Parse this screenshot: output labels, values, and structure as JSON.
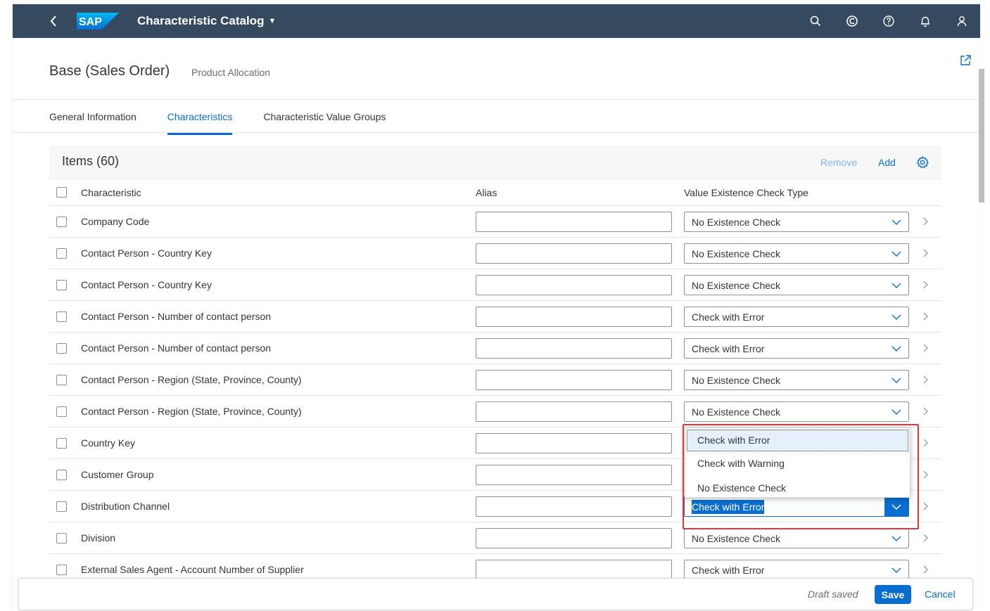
{
  "shell": {
    "logo_text": "SAP",
    "app_title": "Characteristic Catalog",
    "icons": [
      "search-icon",
      "copilot-icon",
      "help-icon",
      "notifications-icon",
      "user-icon"
    ]
  },
  "header": {
    "title": "Base (Sales Order)",
    "subtitle": "Product Allocation"
  },
  "tabs": [
    {
      "label": "General Information",
      "active": false
    },
    {
      "label": "Characteristics",
      "active": true
    },
    {
      "label": "Characteristic Value Groups",
      "active": false
    }
  ],
  "table": {
    "title": "Items (60)",
    "remove_label": "Remove",
    "add_label": "Add",
    "columns": {
      "characteristic": "Characteristic",
      "alias": "Alias",
      "check_type": "Value Existence Check Type"
    },
    "rows": [
      {
        "characteristic": "Company Code",
        "check_type": "No Existence Check"
      },
      {
        "characteristic": "Contact Person - Country Key",
        "check_type": "No Existence Check"
      },
      {
        "characteristic": "Contact Person - Country Key",
        "check_type": "No Existence Check"
      },
      {
        "characteristic": "Contact Person - Number of contact person",
        "check_type": "Check with Error"
      },
      {
        "characteristic": "Contact Person - Number of contact person",
        "check_type": "Check with Error"
      },
      {
        "characteristic": "Contact Person - Region (State, Province, County)",
        "check_type": "No Existence Check"
      },
      {
        "characteristic": "Contact Person - Region (State, Province, County)",
        "check_type": "No Existence Check"
      },
      {
        "characteristic": "Country Key",
        "check_type": ""
      },
      {
        "characteristic": "Customer Group",
        "check_type": ""
      },
      {
        "characteristic": "Distribution Channel",
        "check_type": "Check with Error"
      },
      {
        "characteristic": "Division",
        "check_type": "No Existence Check"
      },
      {
        "characteristic": "External Sales Agent - Account Number of Supplier",
        "check_type": "Check with Error"
      }
    ]
  },
  "dropdown": {
    "options": [
      "Check with Error",
      "Check with Warning",
      "No Existence Check"
    ],
    "selected": "Check with Error"
  },
  "footer": {
    "status": "Draft saved",
    "save_label": "Save",
    "cancel_label": "Cancel"
  },
  "colors": {
    "shell_bg": "#354a5f",
    "accent": "#0a6ed1",
    "highlight": "#e0383a"
  }
}
